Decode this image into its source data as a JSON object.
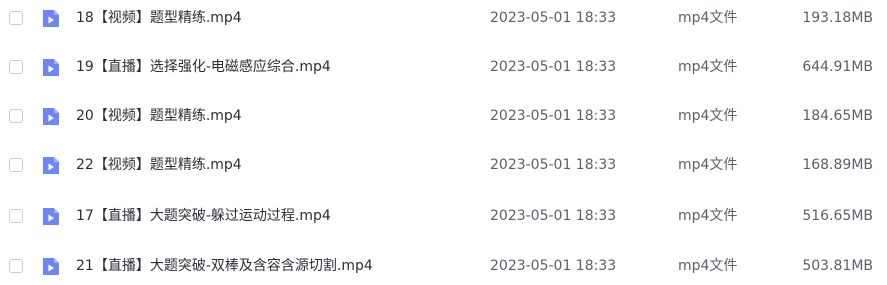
{
  "files": [
    {
      "name": "18【视频】题型精练.mp4",
      "date": "2023-05-01 18:33",
      "type": "mp4文件",
      "size": "193.18MB"
    },
    {
      "name": "19【直播】选择强化-电磁感应综合.mp4",
      "date": "2023-05-01 18:33",
      "type": "mp4文件",
      "size": "644.91MB"
    },
    {
      "name": "20【视频】题型精练.mp4",
      "date": "2023-05-01 18:33",
      "type": "mp4文件",
      "size": "184.65MB"
    },
    {
      "name": "22【视频】题型精练.mp4",
      "date": "2023-05-01 18:33",
      "type": "mp4文件",
      "size": "168.89MB"
    },
    {
      "name": "17【直播】大题突破-躲过运动过程.mp4",
      "date": "2023-05-01 18:33",
      "type": "mp4文件",
      "size": "516.65MB"
    },
    {
      "name": "21【直播】大题突破-双棒及含容含源切割.mp4",
      "date": "2023-05-01 18:33",
      "type": "mp4文件",
      "size": "503.81MB"
    }
  ],
  "icon": {
    "name": "video-file-icon",
    "color": "#6e86f7"
  }
}
